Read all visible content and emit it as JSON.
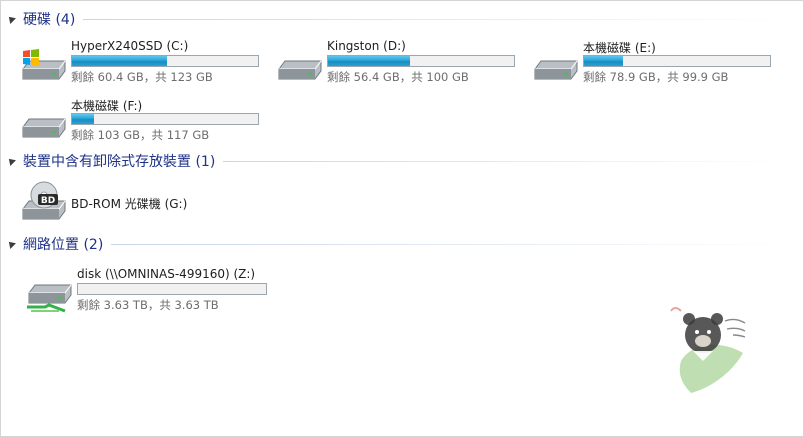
{
  "groups": [
    {
      "title": "硬碟 (4)"
    },
    {
      "title": "裝置中含有卸除式存放裝置 (1)"
    },
    {
      "title": "網路位置 (2)"
    }
  ],
  "hard_drives": [
    {
      "name": "HyperX240SSD (C:)",
      "free": "剩餘 60.4 GB，共 123 GB",
      "used_fraction": 0.51,
      "icon": "windows-system-drive-icon"
    },
    {
      "name": "Kingston (D:)",
      "free": "剩餘 56.4 GB，共 100 GB",
      "used_fraction": 0.44,
      "icon": "hard-drive-icon"
    },
    {
      "name": "本機磁碟 (E:)",
      "free": "剩餘 78.9 GB，共 99.9 GB",
      "used_fraction": 0.21,
      "icon": "hard-drive-icon"
    },
    {
      "name": "本機磁碟 (F:)",
      "free": "剩餘 103 GB，共 117 GB",
      "used_fraction": 0.12,
      "icon": "hard-drive-icon"
    }
  ],
  "removable": [
    {
      "name": "BD-ROM 光碟機 (G:)",
      "icon": "bd-rom-drive-icon",
      "badge": "BD"
    }
  ],
  "network": [
    {
      "name": "disk (\\\\OMNINAS-499160) (Z:)",
      "free": "剩餘 3.63 TB，共 3.63 TB",
      "used_fraction": 0.0,
      "icon": "network-drive-icon"
    }
  ],
  "colors": {
    "header_text": "#1e3287",
    "bar_fill": "#27a4d8",
    "bar_border": "#9aa6b0"
  },
  "watermark": {
    "icon": "bear-mascot-watermark"
  }
}
